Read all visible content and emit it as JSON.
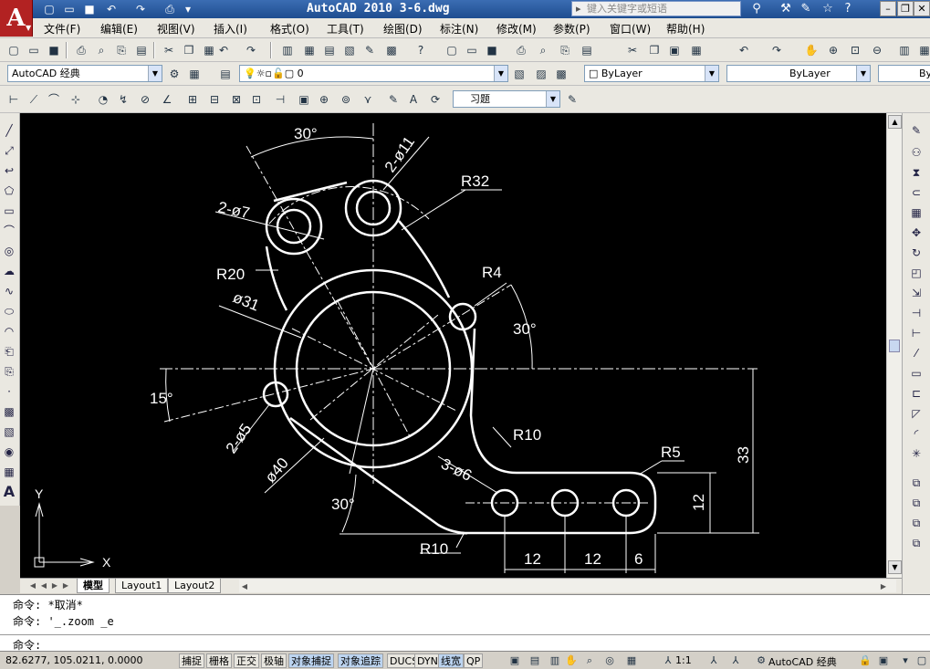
{
  "titlebar": {
    "app_logo": "A",
    "title": "AutoCAD 2010  3-6.dwg",
    "search_placeholder": "键入关键字或短语"
  },
  "menu": [
    "文件(F)",
    "编辑(E)",
    "视图(V)",
    "插入(I)",
    "格式(O)",
    "工具(T)",
    "绘图(D)",
    "标注(N)",
    "修改(M)",
    "参数(P)",
    "窗口(W)",
    "帮助(H)"
  ],
  "workspace": {
    "value": "AutoCAD 经典"
  },
  "layer": {
    "value": "0"
  },
  "color": {
    "value": "ByLayer"
  },
  "linetype": {
    "value": "ByLayer"
  },
  "lineweight": {
    "value": "ByLayer"
  },
  "dimstyle": {
    "value": "习题"
  },
  "drawing": {
    "dims": {
      "angle_top": "30°",
      "holes_11": "2-ø11",
      "holes_7": "2-ø7",
      "r32": "R32",
      "r4": "R4",
      "r20": "R20",
      "d31": "ø31",
      "angle_right": "30°",
      "angle_left": "15°",
      "holes_5": "2-ø5",
      "r10_mid": "R10",
      "r5": "R5",
      "d40": "ø40",
      "holes_6": "3-ø6",
      "angle_bottom": "30°",
      "r10_bottom": "R10",
      "dim_33": "33",
      "dim_12v": "12",
      "dim_12a": "12",
      "dim_12b": "12",
      "dim_6": "6"
    },
    "ucs_x": "X",
    "ucs_y": "Y"
  },
  "tabs": {
    "model": "模型",
    "layout1": "Layout1",
    "layout2": "Layout2"
  },
  "command": {
    "line1": "命令: *取消*",
    "line2": "命令: '_.zoom _e",
    "prompt": "命令:"
  },
  "status": {
    "coords": "82.6277,  105.0211, 0.0000",
    "buttons": [
      "捕捉",
      "栅格",
      "正交",
      "极轴",
      "对象捕捉",
      "对象追踪",
      "DUCS",
      "DYN",
      "线宽",
      "QP"
    ],
    "scale": "1:1",
    "workspace": "AutoCAD 经典"
  },
  "colors": {
    "title_bar": "#1e4d8f",
    "canvas": "#000000",
    "lines": "#ffffff",
    "active_status": "#bcd4f0"
  }
}
